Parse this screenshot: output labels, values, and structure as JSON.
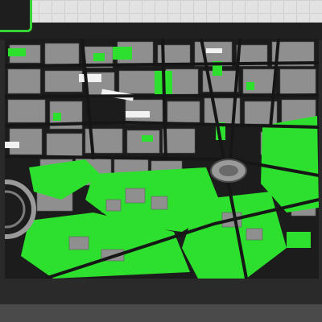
{
  "scene": {
    "description_colors": {
      "bed": "#e2e2e2",
      "frame": "#2a2a2a",
      "roads": "#1c1c1c",
      "buildings": "#9a9a9a",
      "parks": "#2ee02e",
      "white_areas": "#f2f2f2"
    },
    "icon": "3d-city-map-model"
  }
}
